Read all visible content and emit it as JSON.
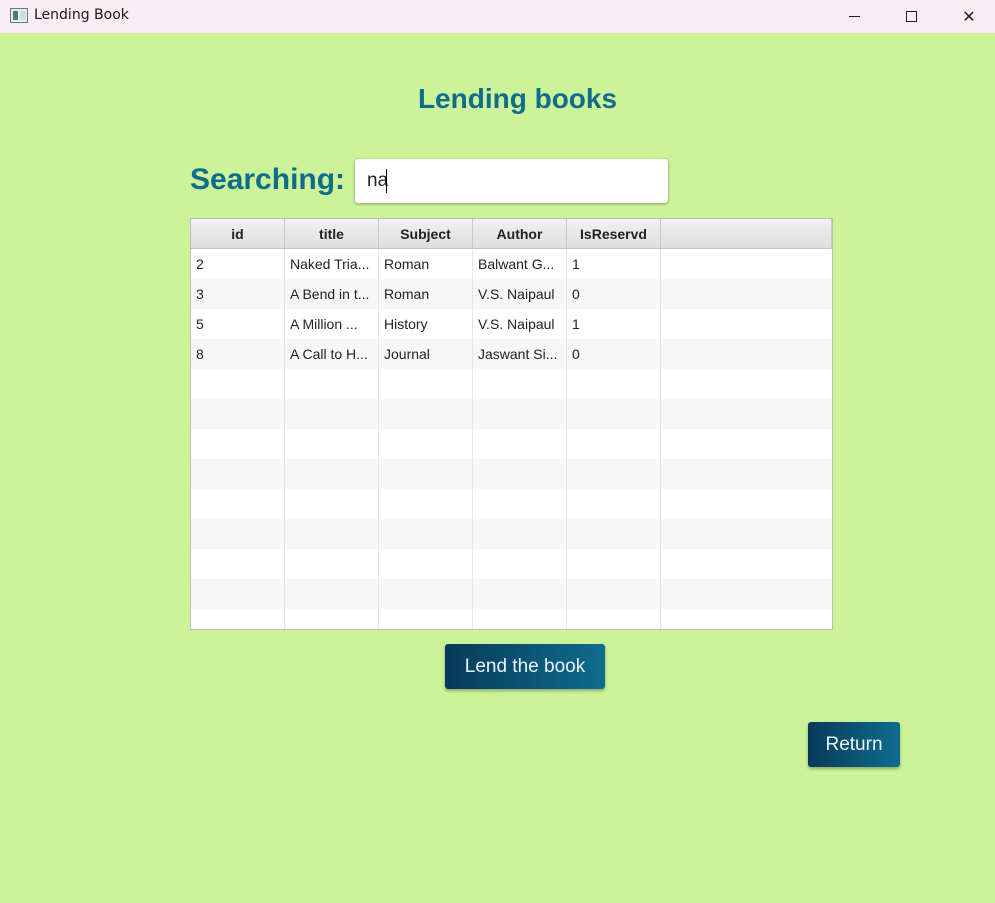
{
  "window": {
    "title": "Lending Book",
    "controls": {
      "minimize": "",
      "maximize": "",
      "close": "✕"
    }
  },
  "page": {
    "heading": "Lending books",
    "search": {
      "label": "Searching:",
      "value": "na"
    }
  },
  "table": {
    "columns": [
      "id",
      "title",
      "Subject",
      "Author",
      "IsReservd"
    ],
    "rows": [
      [
        "2",
        "Naked Tria...",
        "Roman",
        "Balwant G...",
        "1"
      ],
      [
        "3",
        "A Bend in t...",
        "Roman",
        "V.S. Naipaul",
        "0"
      ],
      [
        "5",
        "A Million ...",
        "History",
        "V.S. Naipaul",
        "1"
      ],
      [
        "8",
        "A Call to H...",
        "Journal",
        "Jaswant Si...",
        "0"
      ]
    ]
  },
  "buttons": {
    "lend": "Lend the book",
    "return": "Return"
  },
  "colors": {
    "background": "#ccf39a",
    "accent": "#0e6d8c",
    "button": "#0b4f72"
  },
  "icons": {
    "app": "app-window-icon",
    "minimize": "minimize-icon",
    "maximize": "maximize-icon",
    "close": "close-icon"
  }
}
